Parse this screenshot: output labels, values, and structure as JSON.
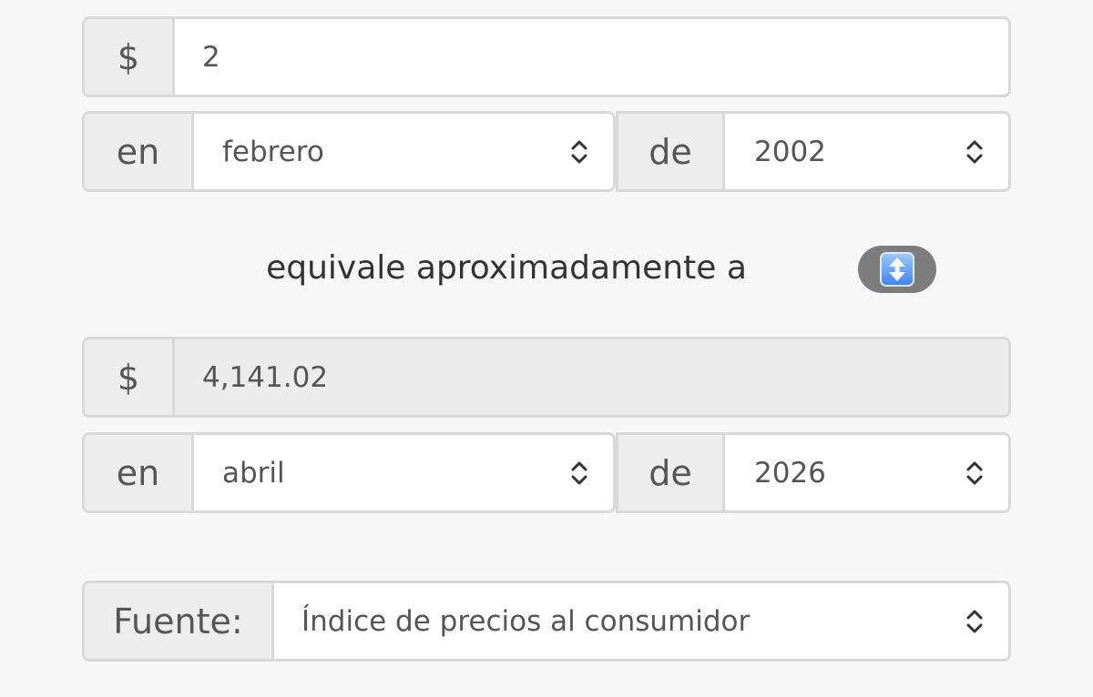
{
  "source_amount": {
    "currency": "$",
    "value": "2"
  },
  "source_date": {
    "prefix": "en",
    "month": "febrero",
    "connector": "de",
    "year": "2002"
  },
  "equivalence_text": "equivale aproximadamente a",
  "swap_icon": "up-down-arrow-icon",
  "result_amount": {
    "currency": "$",
    "value": "4,141.02"
  },
  "target_date": {
    "prefix": "en",
    "month": "abril",
    "connector": "de",
    "year": "2026"
  },
  "source_selector": {
    "label": "Fuente:",
    "value": "Índice de precios al consumidor"
  }
}
